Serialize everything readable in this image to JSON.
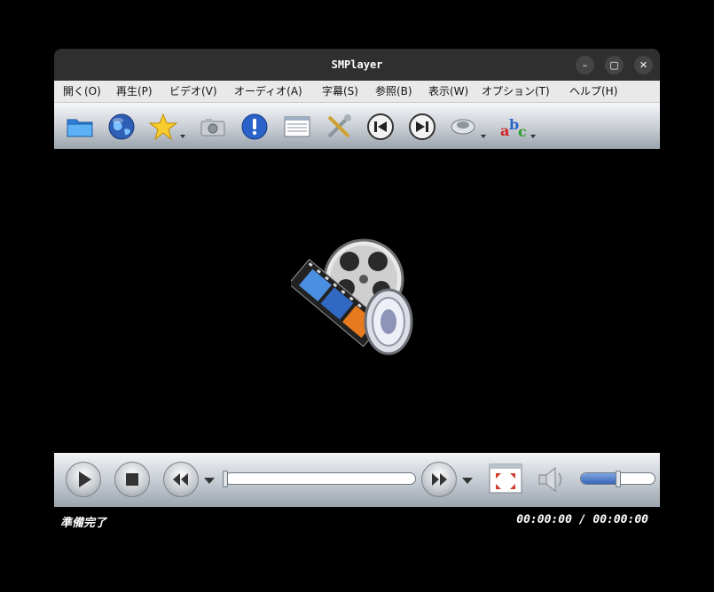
{
  "window": {
    "title": "SMPlayer"
  },
  "window_controls": {
    "minimize": "–",
    "maximize": "▢",
    "close": "✕"
  },
  "menubar": {
    "items": [
      {
        "label": "開く(O)"
      },
      {
        "label": "再生(P)"
      },
      {
        "label": "ビデオ(V)"
      },
      {
        "label": "オーディオ(A)"
      },
      {
        "label": "字幕(S)"
      },
      {
        "label": "参照(B)"
      },
      {
        "label": "表示(W)"
      },
      {
        "label": "オプション(T)"
      },
      {
        "label": "ヘルプ(H)"
      }
    ]
  },
  "toolbar": {
    "icons": [
      "open-folder-icon",
      "open-url-icon",
      "favorites-icon",
      "screenshot-icon",
      "info-icon",
      "playlist-icon",
      "preferences-icon",
      "previous-icon",
      "next-icon",
      "audio-track-icon",
      "subtitle-icon"
    ]
  },
  "controls": {
    "progress": 0,
    "volume": 0.5,
    "icons": [
      "play-icon",
      "stop-icon",
      "rewind-icon",
      "forward-icon",
      "fullscreen-icon",
      "volume-icon"
    ]
  },
  "status": {
    "state": "準備完了",
    "time": "00:00:00 / 00:00:00"
  },
  "colors": {
    "accent": "#3865b8",
    "titlebar": "#2f2f2f",
    "menubar": "#e9e9e9"
  }
}
